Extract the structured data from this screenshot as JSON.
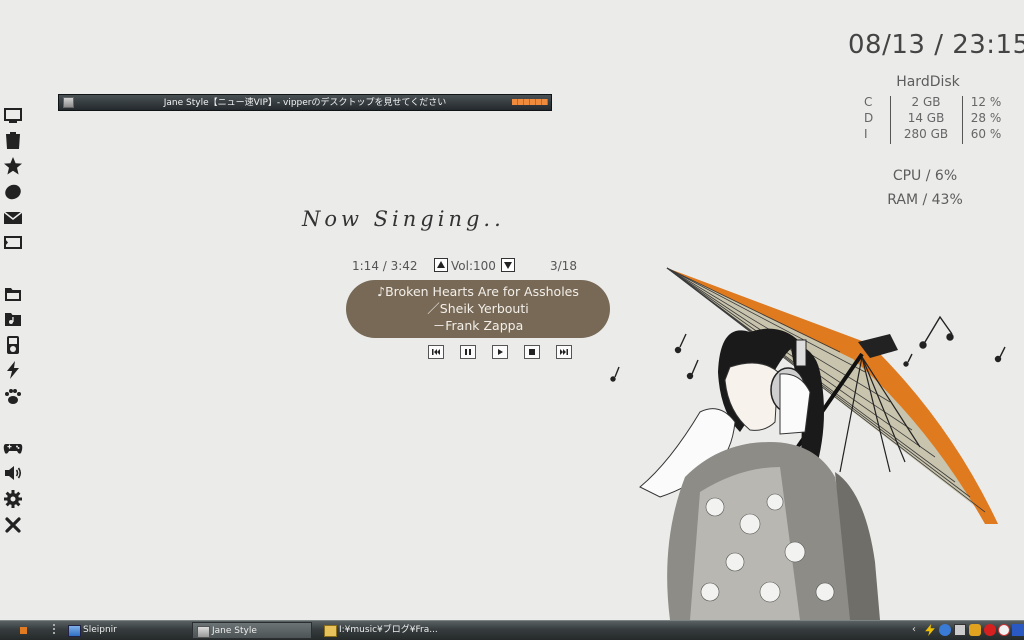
{
  "clock": {
    "datetime": "08/13 / 23:15"
  },
  "disk": {
    "title": "HardDisk",
    "drives": [
      {
        "letter": "C",
        "size": "2 GB",
        "percent": "12 %"
      },
      {
        "letter": "D",
        "size": "14 GB",
        "percent": "28 %"
      },
      {
        "letter": "I",
        "size": "280 GB",
        "percent": "60 %"
      }
    ]
  },
  "system": {
    "cpu": "CPU /  6%",
    "ram": "RAM / 43%"
  },
  "mini_window": {
    "title": "Jane Style【ニュー速VIP】- vipperのデスクトップを見せてください"
  },
  "player": {
    "heading": "Now Singing...",
    "time": "1:14 / 3:42",
    "volume": "Vol:100",
    "track_position": "3/18",
    "song_line1": "♪Broken Hearts Are for Assholes",
    "song_line2": "／Sheik Yerbouti",
    "song_line3": "－Frank Zappa"
  },
  "dock": {
    "icons": [
      "monitor-icon",
      "trash-icon",
      "star-icon",
      "leaf-icon",
      "mail-icon",
      "screen-icon",
      "folder-icon",
      "music-folder-icon",
      "ipod-icon",
      "lightning-icon",
      "paw-icon",
      "gamepad-icon",
      "speaker-icon",
      "gear-icon",
      "close-icon"
    ]
  },
  "taskbar": {
    "buttons": [
      {
        "label": "Sleipnir"
      },
      {
        "label": "Jane Style"
      },
      {
        "label": "I:¥music¥ブログ¥Fra..."
      }
    ]
  },
  "colors": {
    "song_box": "#776956",
    "umbrella": "#e07a1f",
    "background": "#ebebea"
  }
}
